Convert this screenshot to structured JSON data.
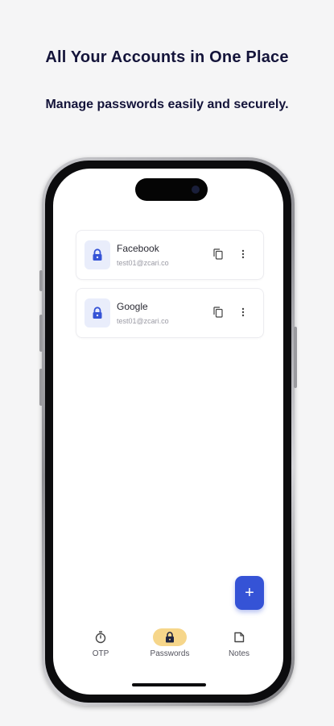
{
  "promo": {
    "headline": "All Your Accounts in One Place",
    "subline": "Manage passwords easily and securely."
  },
  "accounts": [
    {
      "name": "Facebook",
      "email": "test01@zcari.co",
      "icon": "lock-icon"
    },
    {
      "name": "Google",
      "email": "test01@zcari.co",
      "icon": "lock-icon"
    }
  ],
  "fab": {
    "label": "+",
    "icon": "plus-icon"
  },
  "bottom_nav": [
    {
      "label": "OTP",
      "icon": "timer-icon",
      "active": false
    },
    {
      "label": "Passwords",
      "icon": "lock-icon",
      "active": true
    },
    {
      "label": "Notes",
      "icon": "note-icon",
      "active": false
    }
  ],
  "colors": {
    "accent": "#3553d6",
    "active_pill": "#f6d68a",
    "lock_bg": "#e9edfb",
    "headline": "#14143a"
  }
}
